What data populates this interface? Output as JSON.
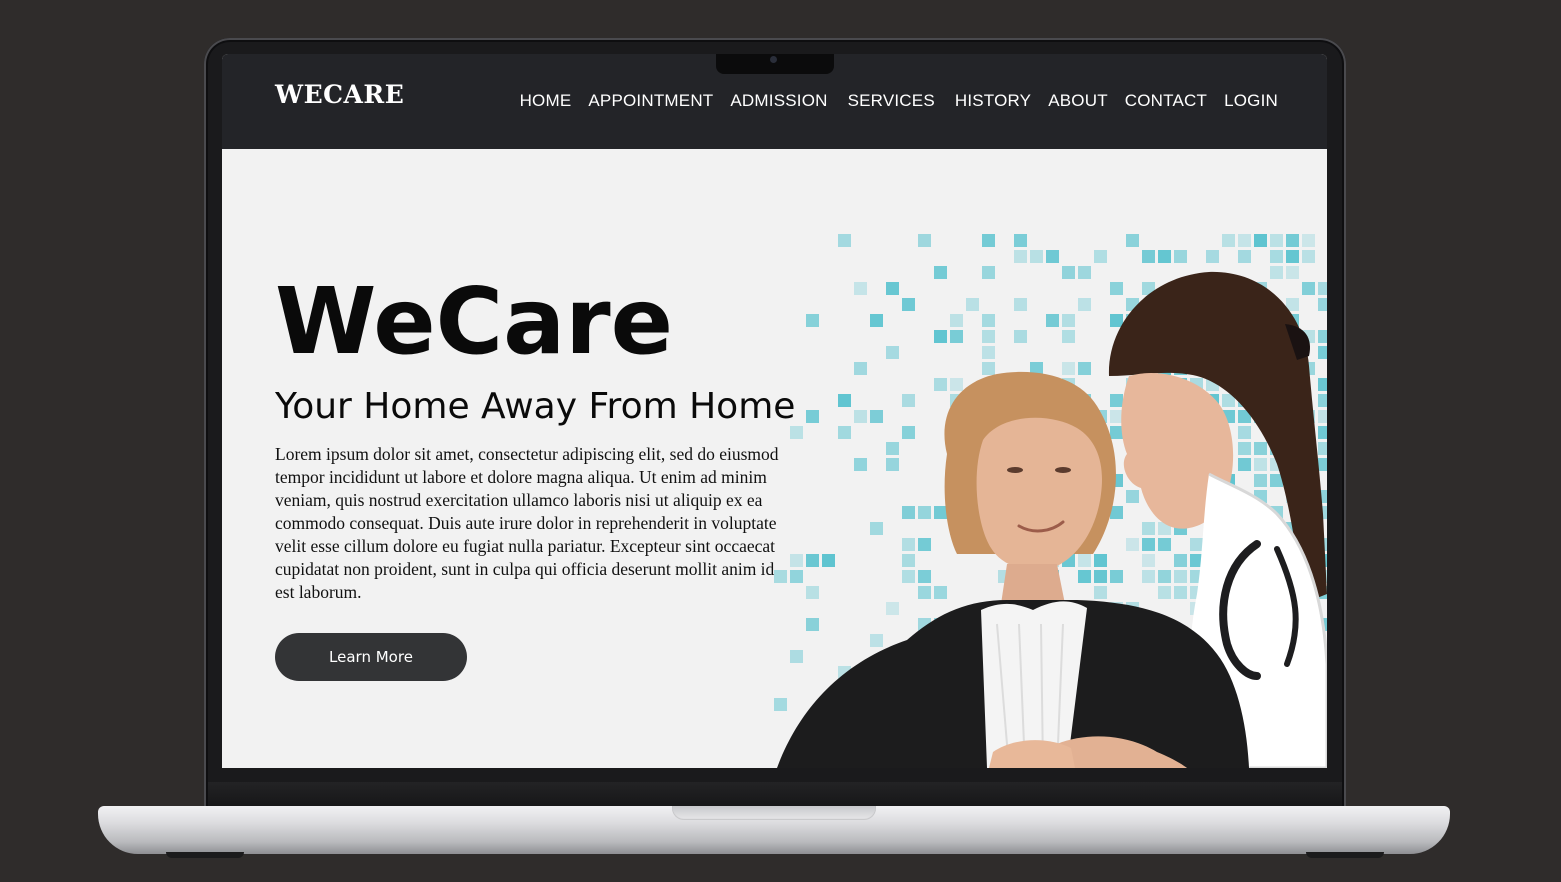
{
  "site": {
    "brand": "WECARE",
    "nav": [
      "HOME",
      "APPOINTMENT",
      "ADMISSION",
      "SERVICES",
      "HISTORY",
      "ABOUT",
      "CONTACT",
      "LOGIN"
    ]
  },
  "hero": {
    "title": "WeCare",
    "subtitle": "Your Home Away From Home",
    "body_lines": [
      "Lorem ipsum dolor sit amet, consectetur adipiscing elit, sed do eiusmod",
      "tempor incididunt ut labore et dolore magna aliqua. Ut enim ad minim",
      "veniam, quis nostrud exercitation ullamco laboris nisi ut aliquip ex ea",
      "commodo consequat. Duis aute irure dolor in reprehenderit in voluptate",
      "velit esse cillum dolore eu fugiat nulla pariatur. Excepteur sint occaecat",
      "cupidatat non proident, sunt in culpa qui officia deserunt mollit anim id",
      "est laborum."
    ],
    "cta_label": "Learn More"
  },
  "colors": {
    "background": "#2f2c2b",
    "navbar": "#232428",
    "screen": "#f2f2f2",
    "button": "#333436",
    "mosaic_teal": "#5cc3cf",
    "mosaic_pink": "#e8336e"
  },
  "icons": {
    "hero_image": "elderly-woman-with-nurse-photo",
    "decoration": "pixel-mosaic-pattern"
  }
}
